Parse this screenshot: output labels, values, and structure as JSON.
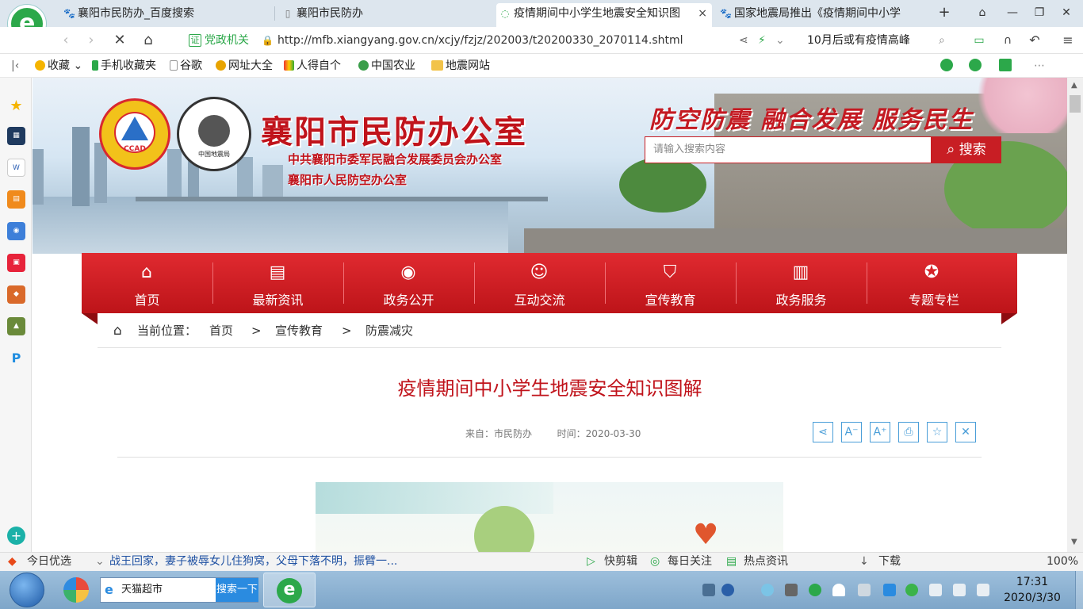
{
  "browser": {
    "tabs": [
      {
        "label": "襄阳市民防办_百度搜索",
        "icon": "paw-icon"
      },
      {
        "label": "襄阳市民防办",
        "icon": "page-icon"
      },
      {
        "label": "疫情期间中小学生地震安全知识图",
        "icon": "loading-icon",
        "close": "×"
      },
      {
        "label": "国家地震局推出《疫情期间中小学",
        "icon": "paw-icon"
      }
    ],
    "new_tab": "+",
    "url_badge": "证",
    "url_badge_label": "党政机关",
    "url": "http://mfb.xiangyang.gov.cn/xcjy/fzjz/202003/t20200330_2070114.shtml",
    "search_hint": "10月后或有疫情高峰",
    "bookmarks": [
      "收藏",
      "手机收藏夹",
      "谷歌",
      "网址大全",
      "人得自个",
      "中国农业",
      "地震网站"
    ],
    "accent": "#2ca84a"
  },
  "site": {
    "title": "襄阳市民防办公室",
    "subtitle1": "中共襄阳市委军民融合发展委员会办公室",
    "subtitle2": "襄阳市人民防空办公室",
    "slogan": "防空防震 融合发展 服务民生",
    "emblem1_text": "CCAD",
    "emblem2_text": "中国地震局",
    "search_placeholder": "请输入搜索内容",
    "search_button": "搜索",
    "brand_color": "#c0131b",
    "nav": [
      {
        "label": "首页",
        "icon": "home-icon"
      },
      {
        "label": "最新资讯",
        "icon": "news-icon"
      },
      {
        "label": "政务公开",
        "icon": "eye-icon"
      },
      {
        "label": "互动交流",
        "icon": "chat-icon"
      },
      {
        "label": "宣传教育",
        "icon": "shield-icon"
      },
      {
        "label": "政务服务",
        "icon": "document-icon"
      },
      {
        "label": "专题专栏",
        "icon": "star-icon"
      }
    ]
  },
  "breadcrumb": {
    "prefix": "当前位置：",
    "items": [
      "首页",
      "宣传教育",
      "防震减灾"
    ],
    "sep": ">"
  },
  "article": {
    "title": "疫情期间中小学生地震安全知识图解",
    "source": "来自：市民防办",
    "time": "时间：2020-03-30",
    "tools": [
      "share-icon",
      "font-decrease-icon",
      "font-increase-icon",
      "print-icon",
      "favorite-icon",
      "close-icon"
    ]
  },
  "statusbar": {
    "today": "今日优选",
    "news": "战王回家，妻子被辱女儿住狗窝，父母下落不明，振臂一...",
    "clip": "快剪辑",
    "follow": "每日关注",
    "hot": "热点资讯",
    "download": "下载",
    "zoom": "100%"
  },
  "taskbar": {
    "search_text": "天猫超市",
    "search_button": "搜索一下",
    "time": "17:31",
    "date": "2020/3/30"
  }
}
